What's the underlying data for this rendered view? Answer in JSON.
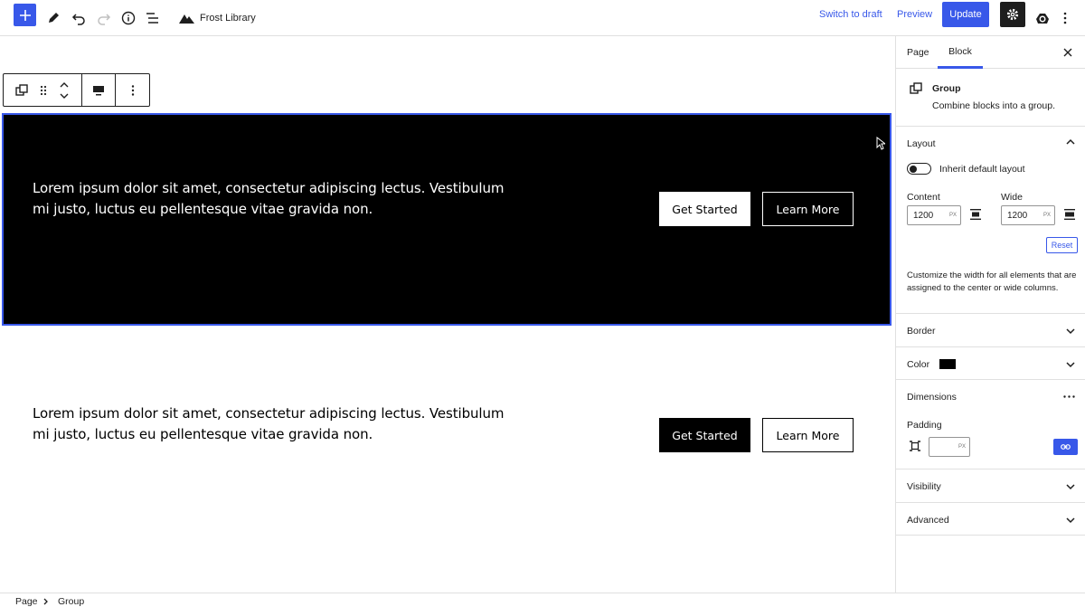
{
  "topbar": {
    "site_title": "Frost Library",
    "switch_to_draft": "Switch to draft",
    "preview": "Preview",
    "update": "Update"
  },
  "canvas": {
    "section1": {
      "text": "Lorem ipsum dolor sit amet, consectetur adipiscing lectus. Vestibulum mi justo, luctus eu pellentesque vitae gravida non.",
      "primary_button": "Get Started",
      "secondary_button": "Learn More"
    },
    "section2": {
      "text": "Lorem ipsum dolor sit amet, consectetur adipiscing lectus. Vestibulum mi justo, luctus eu pellentesque vitae gravida non.",
      "primary_button": "Get Started",
      "secondary_button": "Learn More"
    }
  },
  "sidebar": {
    "tabs": [
      "Page",
      "Block"
    ],
    "active_tab": "Block",
    "block_name": "Group",
    "block_description": "Combine blocks into a group.",
    "layout": {
      "title": "Layout",
      "inherit_label": "Inherit default layout",
      "inherit_enabled": false,
      "content_label": "Content",
      "content_value": "1200",
      "wide_label": "Wide",
      "wide_value": "1200",
      "unit": "PX",
      "reset": "Reset",
      "help": "Customize the width for all elements that are assigned to the center or wide columns."
    },
    "border_title": "Border",
    "color_title": "Color",
    "color_swatch": "#000000",
    "dimensions": {
      "title": "Dimensions",
      "padding_label": "Padding",
      "padding_value": "",
      "unit": "PX"
    },
    "visibility_title": "Visibility",
    "advanced_title": "Advanced"
  },
  "breadcrumb": [
    "Page",
    "Group"
  ],
  "colors": {
    "accent": "#3858e9",
    "dark": "#1e1e1e"
  }
}
